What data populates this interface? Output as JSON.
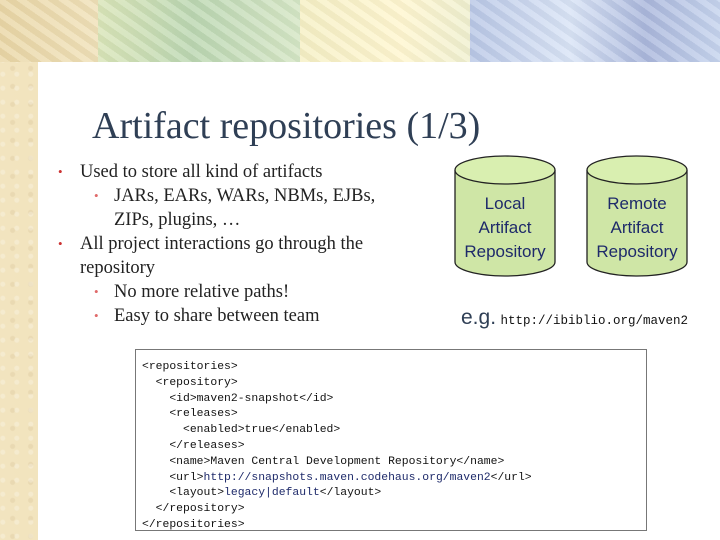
{
  "slide": {
    "title": "Artifact repositories (1/3)",
    "bullets": [
      {
        "level": 1,
        "text": "Used to store all kind of artifacts"
      },
      {
        "level": 2,
        "text": "JARs, EARs, WARs, NBMs, EJBs, ZIPs, plugins, …"
      },
      {
        "level": 1,
        "text": "All project interactions go through the repository"
      },
      {
        "level": 2,
        "text": "No more relative paths!"
      },
      {
        "level": 2,
        "text": "Easy to share between team"
      }
    ],
    "diagram": {
      "local": {
        "line1": "Local",
        "line2": "Artifact",
        "line3": "Repository"
      },
      "remote": {
        "line1": "Remote",
        "line2": "Artifact",
        "line3": "Repository"
      },
      "example_label": "e.g.",
      "example_url": "http://ibiblio.org/maven2"
    },
    "code": {
      "lines": [
        "<repositories>",
        "  <repository>",
        "    <id>maven2-snapshot</id>",
        "    <releases>",
        "      <enabled>true</enabled>",
        "    </releases>",
        "    <name>Maven Central Development Repository</name>",
        "    <url>",
        "http://snapshots.maven.codehaus.org/maven2",
        "</url>",
        "    <layout>",
        "legacy|default",
        "</layout>",
        "  </repository>",
        "</repositories>"
      ]
    }
  },
  "colors": {
    "title": "#2f3f55",
    "cylinder_fill": "#cfe6a6",
    "cylinder_stroke": "#222222",
    "link_text": "#1e2a6a"
  }
}
